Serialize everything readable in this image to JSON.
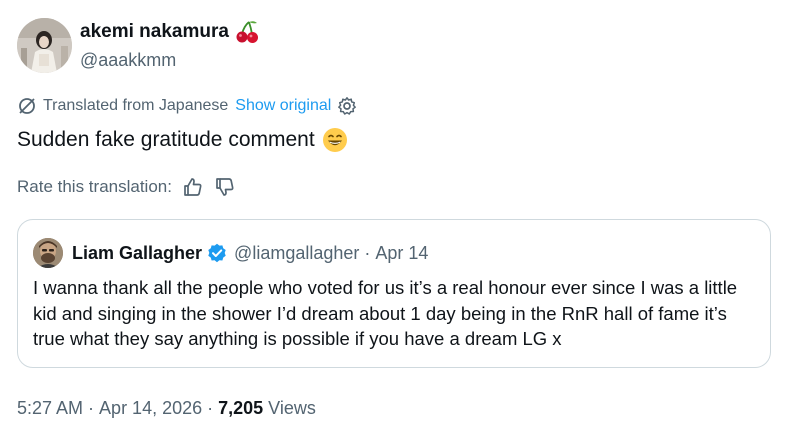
{
  "author": {
    "display_name": "akemi nakamura",
    "name_emoji": "🍒",
    "handle": "@aaakkmm"
  },
  "translation": {
    "label": "Translated from Japanese",
    "show_original": "Show original"
  },
  "tweet": {
    "text": "Sudden fake gratitude comment",
    "emoji": "😄"
  },
  "rating": {
    "label": "Rate this translation:"
  },
  "quoted": {
    "display_name": "Liam Gallagher",
    "handle": "@liamgallagher",
    "separator": "·",
    "date": "Apr 14",
    "text": "I wanna thank all the people who voted for us it’s a real honour ever since I was a little kid and singing in the shower I’d dream about 1 day being in the RnR hall of fame it’s true what they say anything is possible if you have a dream LG x"
  },
  "meta": {
    "time": "5:27 AM",
    "separator": "·",
    "date": "Apr 14, 2026",
    "views_count": "7,205",
    "views_label": "Views"
  },
  "colors": {
    "link": "#1d9bf0",
    "secondary_text": "#536471",
    "primary_text": "#0f1419",
    "border": "#cfd9de",
    "verified": "#1d9bf0"
  },
  "icons": {
    "translate": "translate-slash-icon",
    "settings": "gear-icon",
    "thumbs_up": "thumbs-up-icon",
    "thumbs_down": "thumbs-down-icon",
    "verified": "verified-badge-icon"
  }
}
